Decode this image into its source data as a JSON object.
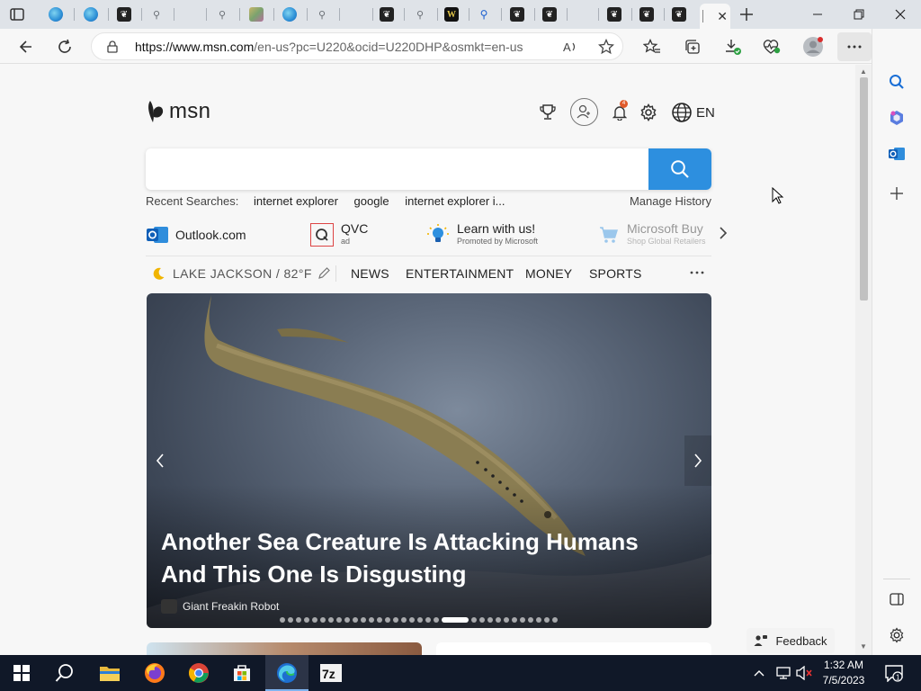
{
  "browser": {
    "url_host": "https://www.msn.com",
    "url_path": "/en-us?pc=U220&ocid=U220DHP&osmkt=en-us"
  },
  "header": {
    "logo_text": "msn",
    "notification_count": "4",
    "language": "EN"
  },
  "search": {
    "placeholder": "",
    "recent_label": "Recent Searches:",
    "recent": [
      "internet explorer",
      "google",
      "internet explorer i..."
    ],
    "manage_history": "Manage History"
  },
  "quicklinks": [
    {
      "title": "Outlook.com",
      "sub": ""
    },
    {
      "title": "QVC",
      "sub": "ad"
    },
    {
      "title": "Learn with us!",
      "sub": "Promoted by Microsoft"
    },
    {
      "title": "Microsoft Buy",
      "sub": "Shop Global Retailers"
    }
  ],
  "navbar": {
    "weather": "LAKE JACKSON / 82°F",
    "items": [
      "NEWS",
      "ENTERTAINMENT",
      "MONEY",
      "SPORTS"
    ]
  },
  "hero": {
    "title": "Another Sea Creature Is Attacking Humans And This One Is Disgusting",
    "source": "Giant Freakin Robot",
    "slide_count": 32,
    "active_slide": 20
  },
  "feedback": "Feedback",
  "taskbar": {
    "time": "1:32 AM",
    "date": "7/5/2023",
    "notification_count": "1"
  },
  "colors": {
    "search_button": "#2d8fdf",
    "taskbar": "#101828",
    "notif_badge": "#e05a2b"
  }
}
